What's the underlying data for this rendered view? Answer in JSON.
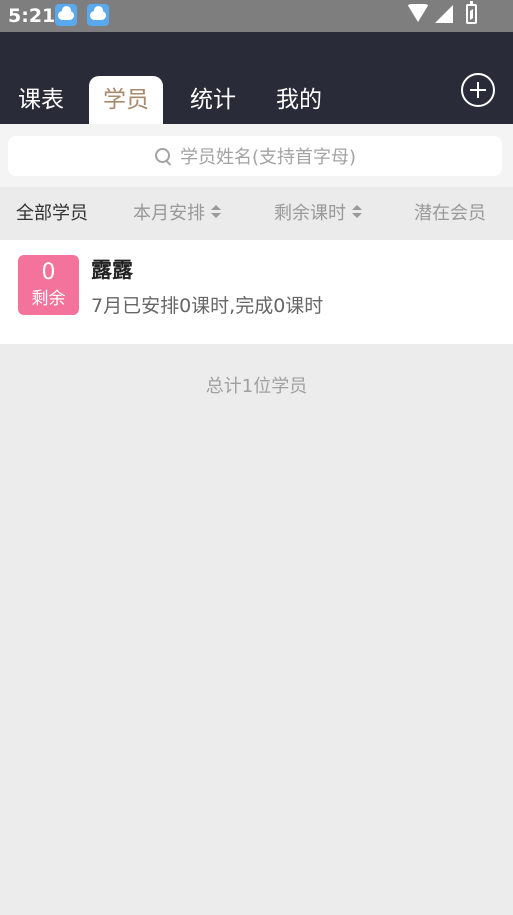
{
  "status_bar": {
    "time": "5:21",
    "icons": [
      "weather-app-icon",
      "weather-app-icon",
      "wifi-icon",
      "signal-icon",
      "battery-charging-icon"
    ]
  },
  "tabs": [
    {
      "label": "课表",
      "active": false
    },
    {
      "label": "学员",
      "active": true
    },
    {
      "label": "统计",
      "active": false
    },
    {
      "label": "我的",
      "active": false
    }
  ],
  "search": {
    "placeholder": "学员姓名(支持首字母)"
  },
  "filters": [
    {
      "label": "全部学员",
      "sortable": false,
      "active": true
    },
    {
      "label": "本月安排",
      "sortable": true,
      "active": false
    },
    {
      "label": "剩余课时",
      "sortable": true,
      "active": false
    },
    {
      "label": "潜在会员",
      "sortable": false,
      "active": false
    }
  ],
  "students": [
    {
      "remaining_count": "0",
      "remaining_label": "剩余",
      "name": "露露",
      "detail": "7月已安排0课时,完成0课时"
    }
  ],
  "total_text": "总计1位学员",
  "colors": {
    "header_bg": "#2a2b38",
    "active_tab_text": "#a7896b",
    "badge_bg": "#f3739d",
    "page_bg": "#ececec"
  }
}
